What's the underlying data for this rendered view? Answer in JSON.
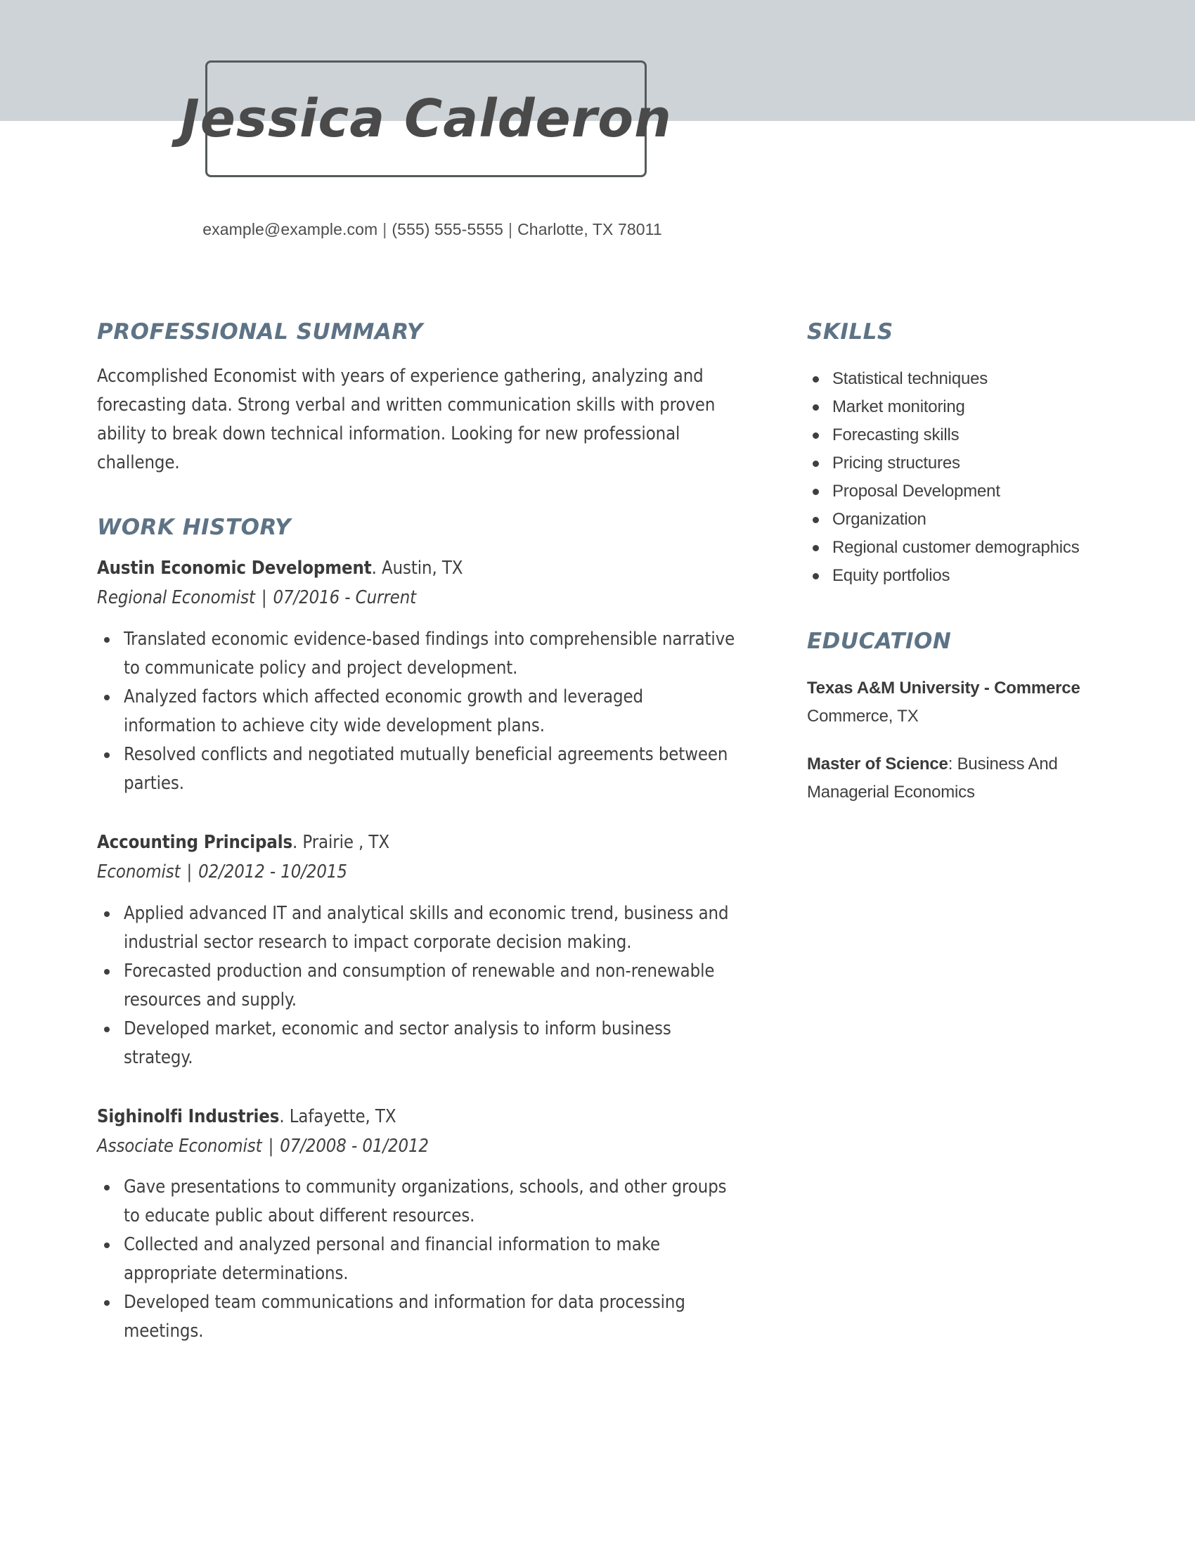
{
  "theme": {
    "band_color": "#cdd3d6",
    "heading_color": "#5e7385",
    "text_color": "#3f3f3f",
    "box_border_color": "#555a5c"
  },
  "header": {
    "name": "Jessica Calderon",
    "contact": {
      "email": "example@example.com",
      "phone": "(555) 555-5555",
      "location": "Charlotte, TX 78011",
      "separator": "|"
    }
  },
  "main": {
    "summary": {
      "title": "PROFESSIONAL SUMMARY",
      "text": "Accomplished Economist with years of experience gathering, analyzing and forecasting data. Strong verbal and written communication skills with proven ability to break down technical information. Looking for new professional challenge."
    },
    "work_history": {
      "title": "WORK HISTORY",
      "jobs": [
        {
          "company": "Austin Economic Development",
          "location": ". Austin, TX",
          "role": "Regional Economist",
          "dates": "07/2016 - Current",
          "separator": "|",
          "duties": [
            "Translated economic evidence-based findings into comprehensible narrative to communicate policy and project development.",
            "Analyzed factors which affected economic growth and leveraged information to achieve city wide development plans.",
            "Resolved conflicts and negotiated mutually beneficial agreements between parties."
          ]
        },
        {
          "company": "Accounting Principals",
          "location": ". Prairie , TX",
          "role": "Economist",
          "dates": "02/2012 - 10/2015",
          "separator": "|",
          "duties": [
            "Applied advanced IT and analytical skills and economic trend, business and industrial sector research to impact corporate decision making.",
            "Forecasted production and consumption of renewable and non-renewable resources and supply.",
            "Developed market, economic and sector analysis to inform business strategy."
          ]
        },
        {
          "company": "Sighinolfi Industries",
          "location": ". Lafayette, TX",
          "role": "Associate Economist",
          "dates": "07/2008 - 01/2012",
          "separator": "|",
          "duties": [
            "Gave presentations to community organizations, schools, and other groups to educate public about different resources.",
            "Collected and analyzed personal and financial information to make appropriate determinations.",
            "Developed team communications and information for data processing meetings."
          ]
        }
      ]
    }
  },
  "sidebar": {
    "skills": {
      "title": "SKILLS",
      "items": [
        "Statistical techniques",
        "Market monitoring",
        "Forecasting skills",
        "Pricing structures",
        "Proposal Development",
        "Organization",
        "Regional customer demographics",
        "Equity portfolios"
      ]
    },
    "education": {
      "title": "EDUCATION",
      "school": "Texas A&M University - Commerce",
      "school_location": "Commerce, TX",
      "degree_label": "Master of Science",
      "degree_field": ": Business And Managerial Economics"
    }
  }
}
